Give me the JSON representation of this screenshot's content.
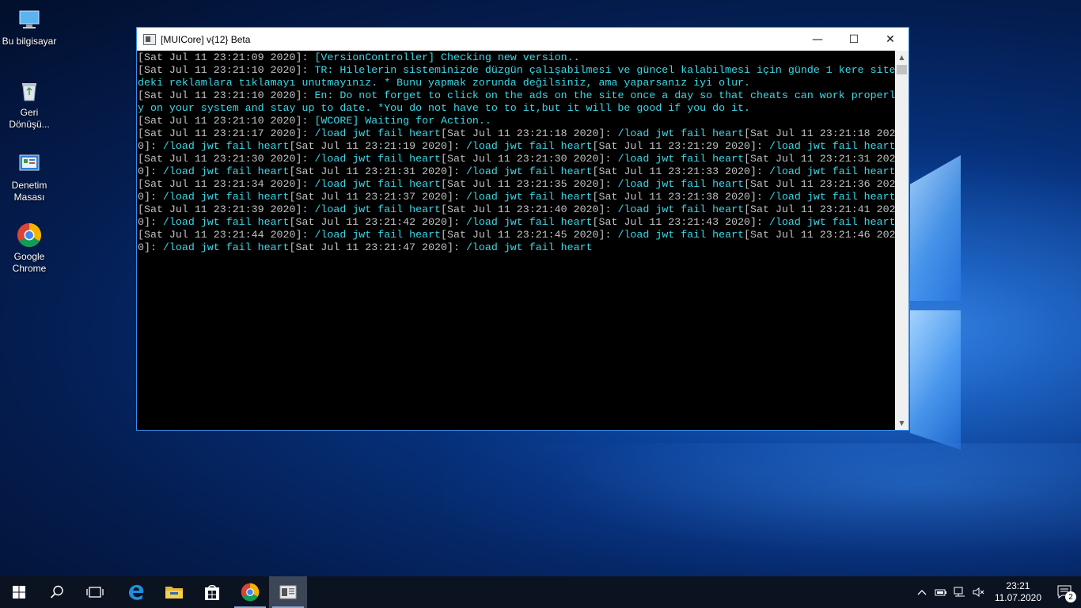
{
  "desktop": {
    "icons": [
      {
        "label": "Bu bilgisayar",
        "icon": "computer-icon"
      },
      {
        "label": "Geri Dönüşü...",
        "icon": "recycle-bin-icon"
      },
      {
        "label": "Denetim Masası",
        "icon": "control-panel-icon"
      },
      {
        "label": "Google Chrome",
        "icon": "chrome-icon"
      }
    ]
  },
  "window": {
    "title": "[MUICore] v{12} Beta",
    "controls": {
      "minimize": "—",
      "maximize": "☐",
      "close": "✕"
    },
    "lines": [
      [
        {
          "t": "ts",
          "v": "[Sat Jul 11 23:21:09 2020]: "
        },
        {
          "t": "msg",
          "v": "[VersionController] Checking new version.."
        }
      ],
      [
        {
          "t": "ts",
          "v": "[Sat Jul 11 23:21:10 2020]: "
        },
        {
          "t": "msg",
          "v": "TR: Hilelerin sisteminizde düzgün çalışabilmesi ve güncel kalabilmesi için günde 1 kere site"
        }
      ],
      [
        {
          "t": "msg",
          "v": "deki reklamlara tıklamayı unutmayınız. * Bunu yapmak zorunda değilsiniz, ama yaparsanız iyi olur."
        }
      ],
      [
        {
          "t": "ts",
          "v": "[Sat Jul 11 23:21:10 2020]: "
        },
        {
          "t": "msg",
          "v": "En: Do not forget to click on the ads on the site once a day so that cheats can work properl"
        }
      ],
      [
        {
          "t": "msg",
          "v": "y on your system and stay up to date. *You do not have to to it,but it will be good if you do it."
        }
      ],
      [
        {
          "t": "ts",
          "v": "[Sat Jul 11 23:21:10 2020]: "
        },
        {
          "t": "msg",
          "v": "[WCORE] Waiting for Action.."
        }
      ],
      [
        {
          "t": "ts",
          "v": "[Sat Jul 11 23:21:17 2020]: "
        },
        {
          "t": "msg",
          "v": "/load jwt fail heart"
        },
        {
          "t": "ts",
          "v": "[Sat Jul 11 23:21:18 2020]: "
        },
        {
          "t": "msg",
          "v": "/load jwt fail heart"
        },
        {
          "t": "ts",
          "v": "[Sat Jul 11 23:21:18 202"
        }
      ],
      [
        {
          "t": "ts",
          "v": "0]: "
        },
        {
          "t": "msg",
          "v": "/load jwt fail heart"
        },
        {
          "t": "ts",
          "v": "[Sat Jul 11 23:21:19 2020]: "
        },
        {
          "t": "msg",
          "v": "/load jwt fail heart"
        },
        {
          "t": "ts",
          "v": "[Sat Jul 11 23:21:29 2020]: "
        },
        {
          "t": "msg",
          "v": "/load jwt fail heart"
        }
      ],
      [
        {
          "t": "ts",
          "v": "[Sat Jul 11 23:21:30 2020]: "
        },
        {
          "t": "msg",
          "v": "/load jwt fail heart"
        },
        {
          "t": "ts",
          "v": "[Sat Jul 11 23:21:30 2020]: "
        },
        {
          "t": "msg",
          "v": "/load jwt fail heart"
        },
        {
          "t": "ts",
          "v": "[Sat Jul 11 23:21:31 202"
        }
      ],
      [
        {
          "t": "ts",
          "v": "0]: "
        },
        {
          "t": "msg",
          "v": "/load jwt fail heart"
        },
        {
          "t": "ts",
          "v": "[Sat Jul 11 23:21:31 2020]: "
        },
        {
          "t": "msg",
          "v": "/load jwt fail heart"
        },
        {
          "t": "ts",
          "v": "[Sat Jul 11 23:21:33 2020]: "
        },
        {
          "t": "msg",
          "v": "/load jwt fail heart"
        }
      ],
      [
        {
          "t": "ts",
          "v": "[Sat Jul 11 23:21:34 2020]: "
        },
        {
          "t": "msg",
          "v": "/load jwt fail heart"
        },
        {
          "t": "ts",
          "v": "[Sat Jul 11 23:21:35 2020]: "
        },
        {
          "t": "msg",
          "v": "/load jwt fail heart"
        },
        {
          "t": "ts",
          "v": "[Sat Jul 11 23:21:36 202"
        }
      ],
      [
        {
          "t": "ts",
          "v": "0]: "
        },
        {
          "t": "msg",
          "v": "/load jwt fail heart"
        },
        {
          "t": "ts",
          "v": "[Sat Jul 11 23:21:37 2020]: "
        },
        {
          "t": "msg",
          "v": "/load jwt fail heart"
        },
        {
          "t": "ts",
          "v": "[Sat Jul 11 23:21:38 2020]: "
        },
        {
          "t": "msg",
          "v": "/load jwt fail heart"
        }
      ],
      [
        {
          "t": "ts",
          "v": "[Sat Jul 11 23:21:39 2020]: "
        },
        {
          "t": "msg",
          "v": "/load jwt fail heart"
        },
        {
          "t": "ts",
          "v": "[Sat Jul 11 23:21:40 2020]: "
        },
        {
          "t": "msg",
          "v": "/load jwt fail heart"
        },
        {
          "t": "ts",
          "v": "[Sat Jul 11 23:21:41 202"
        }
      ],
      [
        {
          "t": "ts",
          "v": "0]: "
        },
        {
          "t": "msg",
          "v": "/load jwt fail heart"
        },
        {
          "t": "ts",
          "v": "[Sat Jul 11 23:21:42 2020]: "
        },
        {
          "t": "msg",
          "v": "/load jwt fail heart"
        },
        {
          "t": "ts",
          "v": "[Sat Jul 11 23:21:43 2020]: "
        },
        {
          "t": "msg",
          "v": "/load jwt fail heart"
        }
      ],
      [
        {
          "t": "ts",
          "v": "[Sat Jul 11 23:21:44 2020]: "
        },
        {
          "t": "msg",
          "v": "/load jwt fail heart"
        },
        {
          "t": "ts",
          "v": "[Sat Jul 11 23:21:45 2020]: "
        },
        {
          "t": "msg",
          "v": "/load jwt fail heart"
        },
        {
          "t": "ts",
          "v": "[Sat Jul 11 23:21:46 202"
        }
      ],
      [
        {
          "t": "ts",
          "v": "0]: "
        },
        {
          "t": "msg",
          "v": "/load jwt fail heart"
        },
        {
          "t": "ts",
          "v": "[Sat Jul 11 23:21:47 2020]: "
        },
        {
          "t": "msg",
          "v": "/load jwt fail heart"
        }
      ]
    ],
    "colors": {
      "timestamp": "#c0c0c0",
      "message": "#3ad8e8",
      "background": "#000000"
    }
  },
  "taskbar": {
    "items": [
      {
        "icon": "start-icon"
      },
      {
        "icon": "search-icon"
      },
      {
        "icon": "task-view-icon"
      },
      {
        "icon": "edge-icon"
      },
      {
        "icon": "file-explorer-icon"
      },
      {
        "icon": "store-icon"
      },
      {
        "icon": "chrome-icon",
        "running": true
      },
      {
        "icon": "console-app-icon",
        "active": true
      }
    ],
    "tray": {
      "icons": [
        "chevron-up-icon",
        "battery-icon",
        "network-icon",
        "volume-muted-icon"
      ],
      "time": "23:21",
      "date": "11.07.2020",
      "notification_count": "2"
    }
  }
}
